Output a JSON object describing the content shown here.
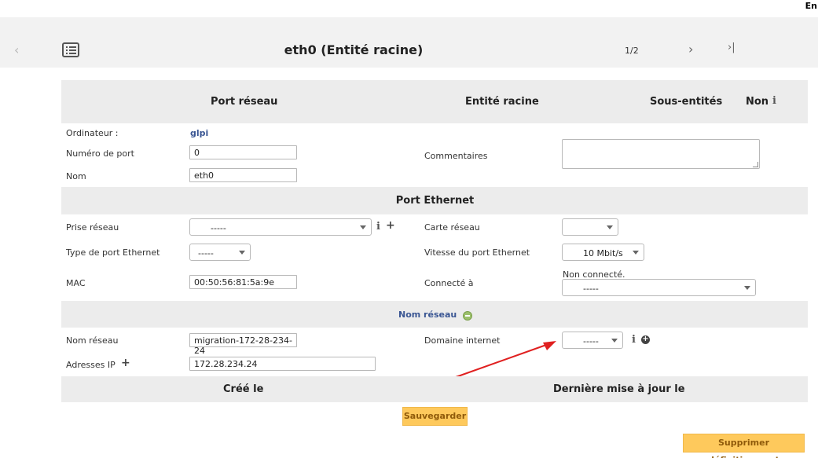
{
  "header": {
    "lang": "En",
    "title": "eth0 (Entité racine)",
    "pager": "1/2",
    "prev_icon": "chevron-left-icon",
    "list_icon": "list-icon",
    "next_icon": "chevron-right-icon",
    "last_icon": "skip-last-icon"
  },
  "summary": {
    "item_type": "Port réseau",
    "entity": "Entité racine",
    "sub_entities_label": "Sous-entités",
    "sub_entities_value": "Non"
  },
  "general": {
    "computer_label": "Ordinateur :",
    "computer_value": "glpi",
    "port_number_label": "Numéro de port",
    "port_number_value": "0",
    "name_label": "Nom",
    "name_value": "eth0",
    "comments_label": "Commentaires",
    "comments_value": ""
  },
  "ethernet": {
    "section_title": "Port Ethernet",
    "socket_label": "Prise réseau",
    "socket_value": "-----",
    "card_label": "Carte réseau",
    "card_value": "",
    "type_label": "Type de port Ethernet",
    "type_value": "-----",
    "speed_label": "Vitesse du port Ethernet",
    "speed_value": "10 Mbit/s",
    "mac_label": "MAC",
    "mac_value": "00:50:56:81:5a:9e",
    "connected_label": "Connecté à",
    "connected_status": "Non connecté.",
    "connected_value": "-----"
  },
  "network_name": {
    "section_title": "Nom réseau",
    "name_label": "Nom réseau",
    "name_value": "migration-172-28-234-24",
    "domain_label": "Domaine internet",
    "domain_value": "-----",
    "ip_label": "Adresses IP",
    "ip_value": "172.28.234.24"
  },
  "footer": {
    "created_label": "Créé le",
    "updated_label": "Dernière mise à jour le",
    "save_label": "Sauvegarder",
    "delete_label": "Supprimer définitivement"
  },
  "colors": {
    "section_bg": "#ececec",
    "button_bg": "#fec95c",
    "button_text": "#8f5a0a",
    "link": "#3a5693",
    "arrow": "#e02020"
  }
}
